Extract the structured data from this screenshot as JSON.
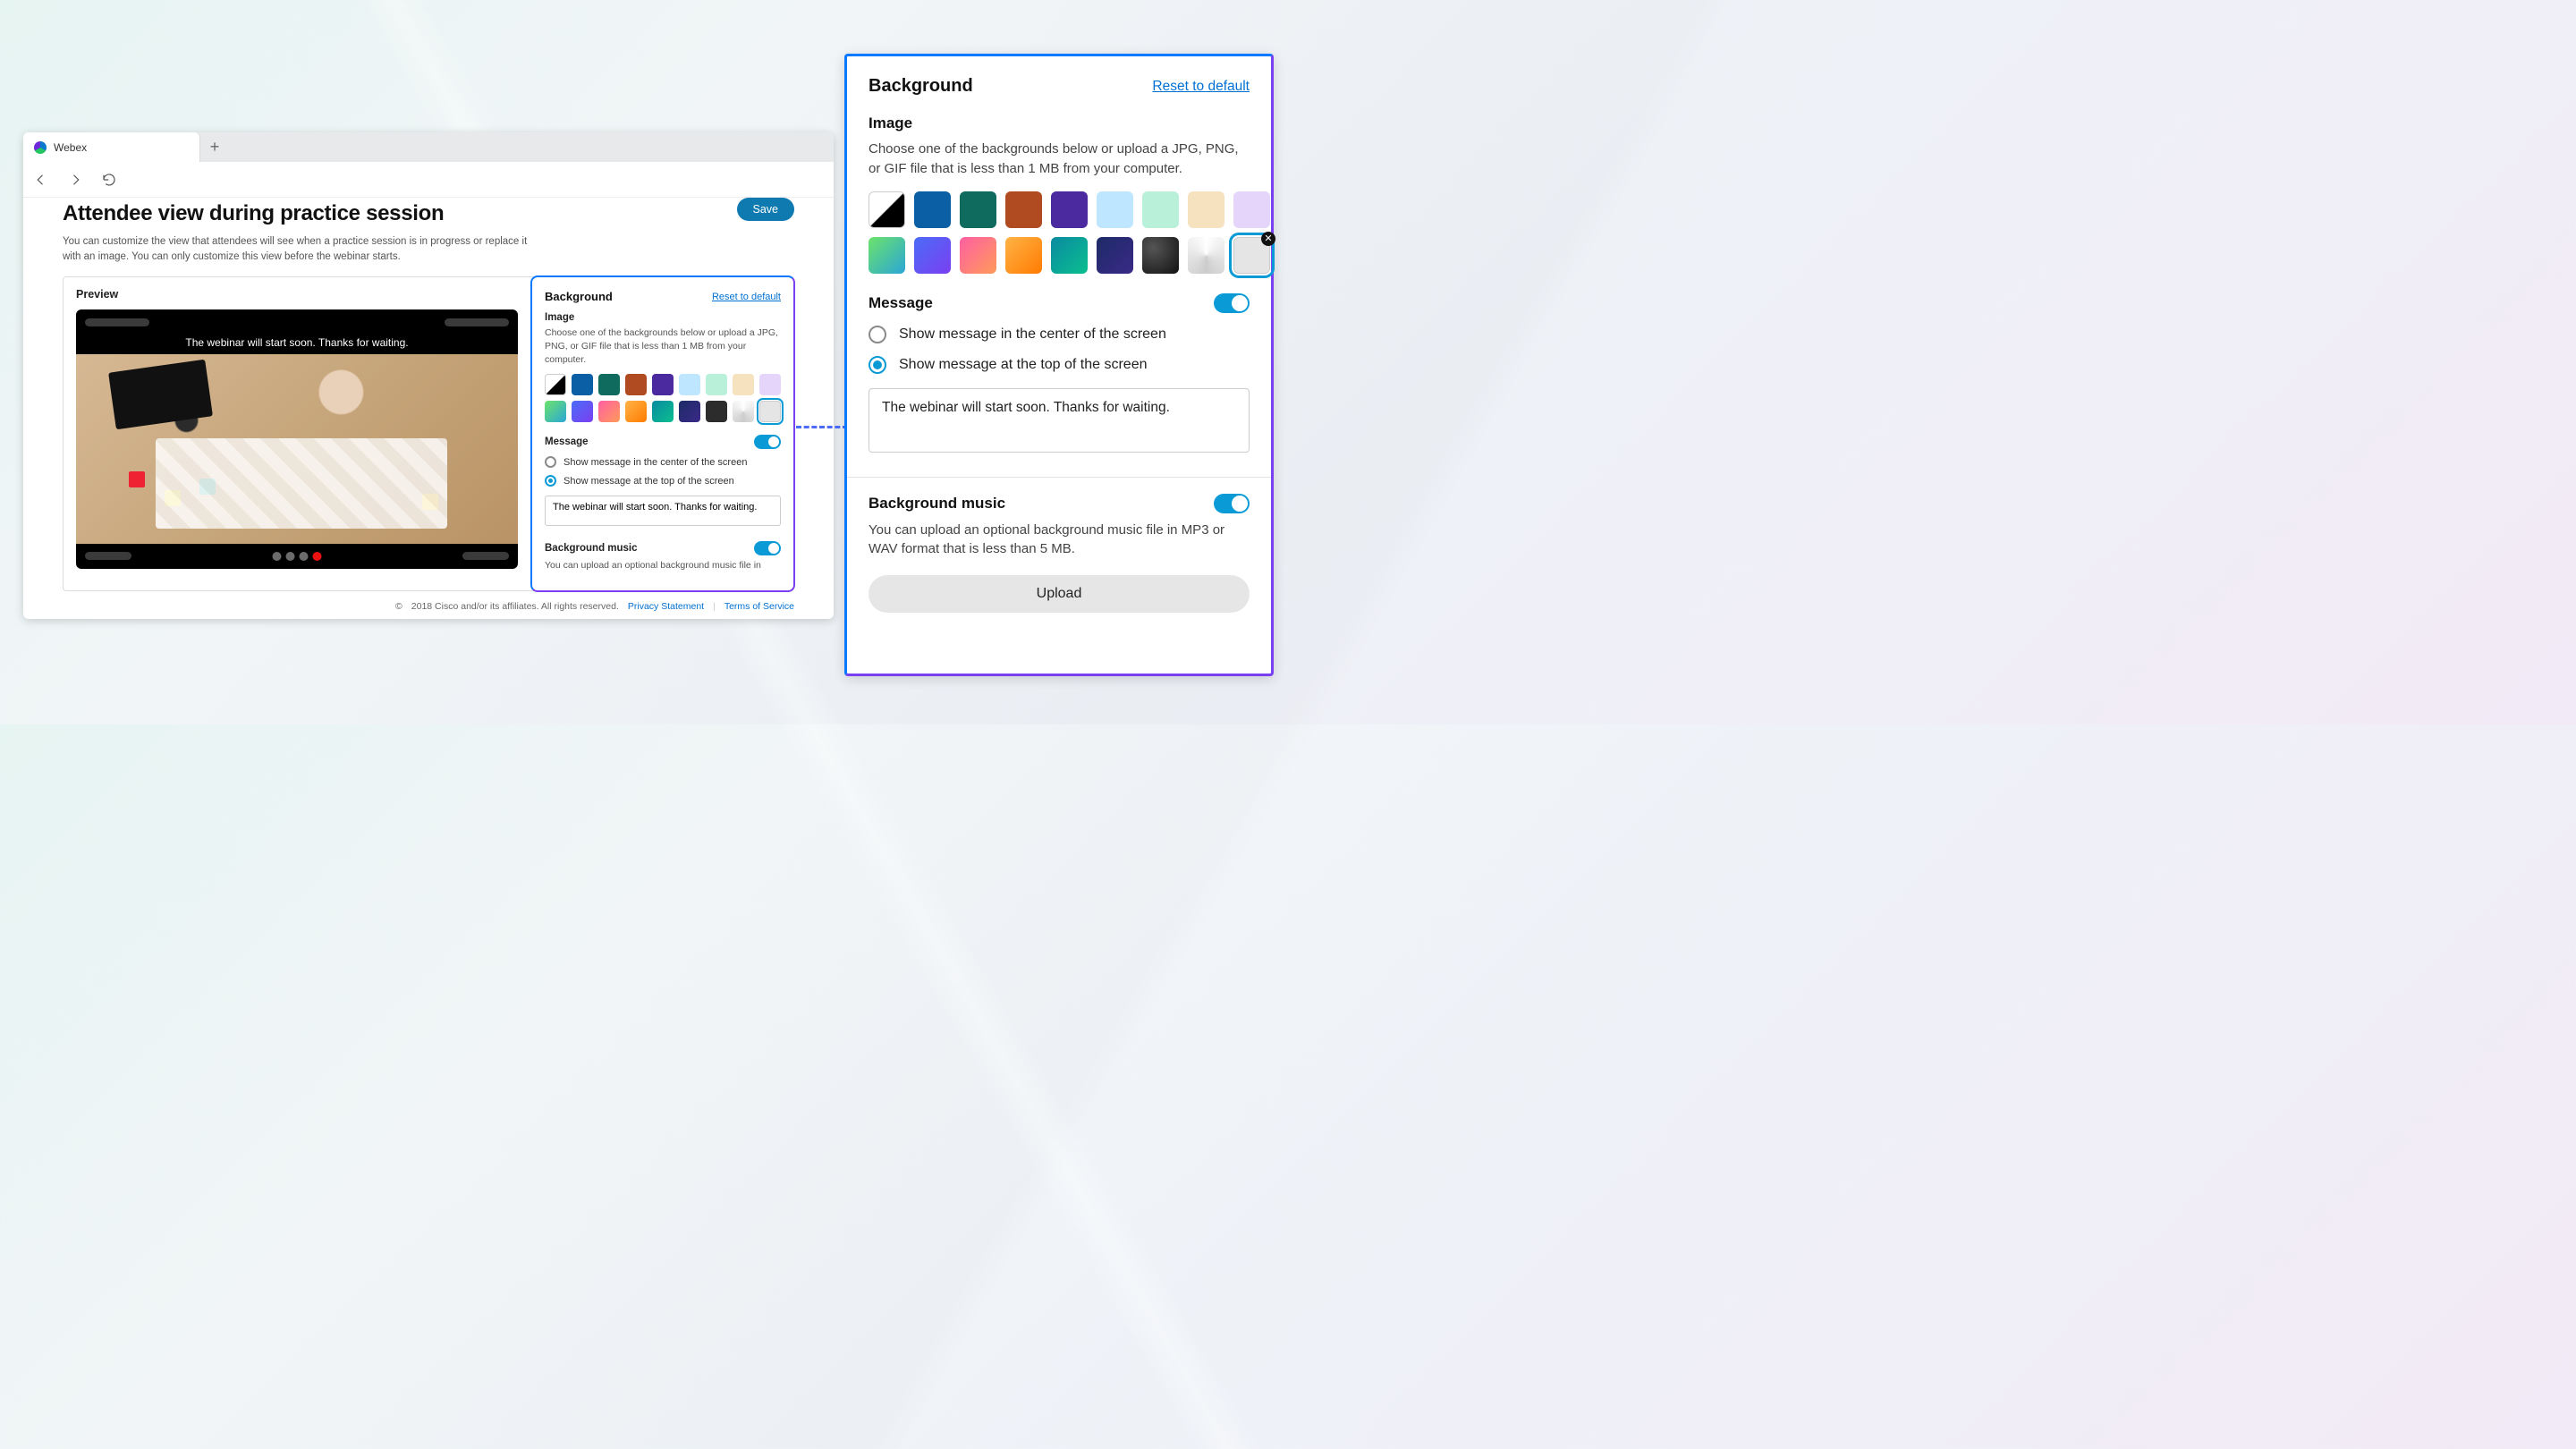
{
  "browser": {
    "tab_title": "Webex",
    "new_tab_glyph": "+"
  },
  "page": {
    "title": "Attendee view during practice session",
    "subtitle": "You can customize the view that attendees will see when a practice session is in progress or replace it with an image. You can only customize this view before the webinar starts.",
    "save_label": "Save",
    "preview_label": "Preview",
    "preview_message": "The webinar will start soon. Thanks for waiting."
  },
  "settings": {
    "heading": "Background",
    "reset_label": "Reset to default",
    "image_label": "Image",
    "image_desc": "Choose one of the backgrounds below or upload a JPG, PNG, or GIF file that is less than 1 MB from your computer.",
    "swatches_row1": [
      "split-bw",
      "#0b5fa5",
      "#0e6b5e",
      "#b04a20",
      "#4a2a9e",
      "#bfe6ff",
      "#b8f0da",
      "#f7e2c0",
      "#e6d5fb"
    ],
    "swatches_row2": [
      "grad-green",
      "grad-blue",
      "grad-pink",
      "grad-orange",
      "#0a8aa0",
      "#1d2b66",
      "#2c2c2c",
      "conic-grey",
      "#e5e5e5"
    ],
    "selected_swatch": "#e5e5e5",
    "message_label": "Message",
    "radio_center": "Show message in the center of the screen",
    "radio_top": "Show message at the top of the screen",
    "message_value": "The webinar will start soon. Thanks for waiting.",
    "music_label": "Background music",
    "music_desc_short": "You can upload an optional background music file in",
    "music_desc_full": "You can upload an optional background music file in MP3 or WAV format that is less than 5 MB.",
    "upload_label": "Upload"
  },
  "footer": {
    "copyright": "2018 Cisco and/or its affiliates. All rights reserved.",
    "privacy": "Privacy Statement",
    "terms": "Terms of Service"
  }
}
